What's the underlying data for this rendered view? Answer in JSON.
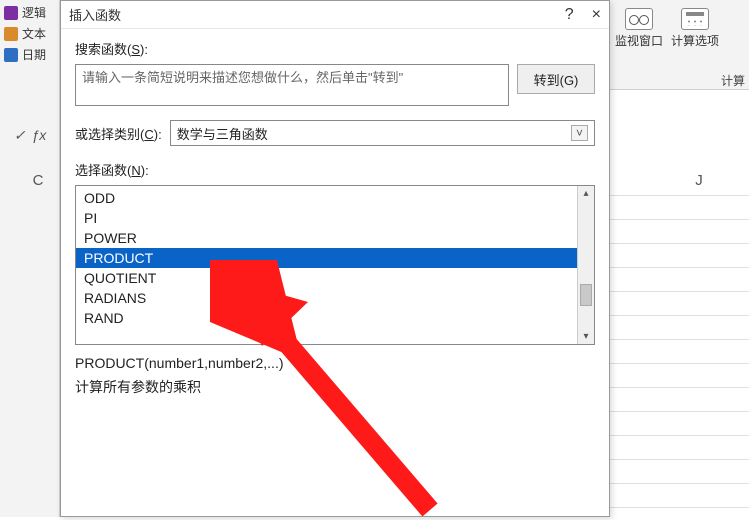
{
  "ribbon_left": {
    "items": [
      "逻辑",
      "文本",
      "日期"
    ]
  },
  "ribbon_right": {
    "watch_window": "监视窗口",
    "calc_options": "计算选项",
    "sub_label": "计算"
  },
  "columns": {
    "c": "C",
    "j": "J"
  },
  "formula_bar": {
    "check": "✓",
    "fx": "ƒx"
  },
  "dialog": {
    "title": "插入函数",
    "help": "?",
    "close": "×",
    "search_label_pre": "搜索函数(",
    "search_label_u": "S",
    "search_label_post": "):",
    "search_placeholder": "请输入一条简短说明来描述您想做什么，然后单击\"转到\"",
    "go_button": "转到(G)",
    "category_label_pre": "或选择类别(",
    "category_label_u": "C",
    "category_label_post": "):",
    "category_value": "数学与三角函数",
    "select_label_pre": "选择函数(",
    "select_label_u": "N",
    "select_label_post": "):",
    "functions": [
      "ODD",
      "PI",
      "POWER",
      "PRODUCT",
      "QUOTIENT",
      "RADIANS",
      "RAND"
    ],
    "selected_index": 3,
    "signature": "PRODUCT(number1,number2,...)",
    "description": "计算所有参数的乘积"
  },
  "annotation": {
    "color": "#ff1a1a"
  }
}
